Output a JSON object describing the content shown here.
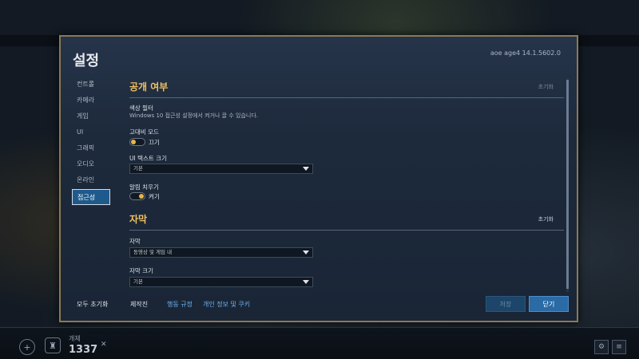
{
  "dialog": {
    "title": "설정",
    "version": "aoe   age4  14.1.5602.0"
  },
  "nav": {
    "items": [
      "컨트롤",
      "카메라",
      "게임",
      "UI",
      "그래픽",
      "오디오",
      "온라인",
      "접근성"
    ],
    "active_index": 7
  },
  "sections": {
    "visibility": {
      "title": "공개 여부",
      "reset": "초기화",
      "color_filter": {
        "label": "색상 필터",
        "note": "Windows 10 접근성 설정에서 켜거나 끌 수 있습니다."
      },
      "high_contrast": {
        "label": "고대비 모드",
        "state_text": "끄기",
        "on": false
      },
      "ui_text_size": {
        "label": "UI 텍스트 크기",
        "value": "기본"
      },
      "clear_notifications": {
        "label": "알림 치우기",
        "state_text": "켜기",
        "on": true
      }
    },
    "subtitles": {
      "title": "자막",
      "reset": "초기화",
      "subtitle": {
        "label": "자막",
        "value": "동영상 및 게임 내"
      },
      "subtitle_size": {
        "label": "자막 크기",
        "value": "기본"
      }
    }
  },
  "footer": {
    "reset_all": "모두 초기화",
    "credits": "제작진",
    "conduct": "행동 규정",
    "privacy": "개인 정보 및 쿠키",
    "save": "저장",
    "close": "닫기"
  },
  "background": {
    "stat_label": "개체",
    "stat_value": "1337"
  },
  "colors": {
    "accent_gold": "#f0c060",
    "active_nav": "#1f5a8c",
    "primary_button": "#2a6aa5",
    "link_blue": "#6fb0f0",
    "dialog_border": "#8a7a55"
  }
}
